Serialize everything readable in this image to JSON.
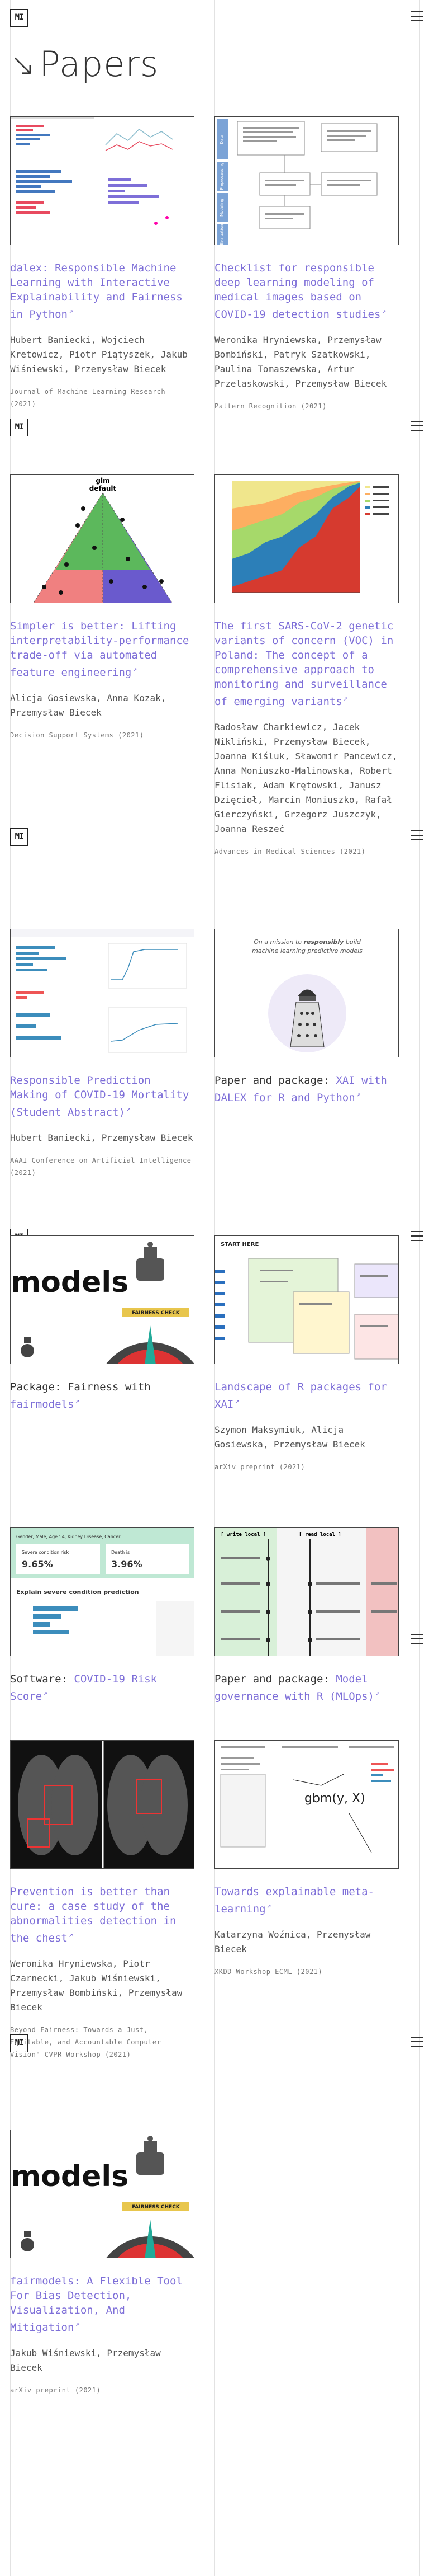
{
  "header": {
    "logo_text": "MI",
    "menu_icon": "hamburger-icon"
  },
  "page_title": "Papers",
  "title_icon": "arrow-down-right-icon",
  "external_icon_glyph": "↗",
  "papers": [
    {
      "title": "dalex: Responsible Machine Learning with Interactive Explainability and Fairness in Python",
      "prefix": "",
      "authors": "Hubert Baniecki, Wojciech Kretowicz, Piotr Piątyszek, Jakub Wiśniewski, Przemysław Biecek",
      "venue": "Journal of Machine Learning Research (2021)"
    },
    {
      "title": "Checklist for responsible deep learning modeling of medical images based on COVID-19 detection studies",
      "prefix": "",
      "authors": "Weronika Hryniewska, Przemysław Bombiński, Patryk Szatkowski, Paulina Tomaszewska, Artur Przelaskowski, Przemysław Biecek",
      "venue": "Pattern Recognition (2021)"
    },
    {
      "title": "Simpler is better: Lifting interpretability-performance trade-off via automated feature engineering",
      "prefix": "",
      "authors": "Alicja Gosiewska, Anna Kozak, Przemysław Biecek",
      "venue": "Decision Support Systems (2021)"
    },
    {
      "title": "The first SARS-CoV-2 genetic variants of concern (VOC) in Poland: The concept of a comprehensive approach to monitoring and surveillance of emerging variants",
      "prefix": "",
      "authors": "Radosław Charkiewicz, Jacek Nikliński, Przemysław Biecek, Joanna Kiśluk, Sławomir Pancewicz, Anna Moniuszko-Malinowska, Robert Flisiak, Adam Krętowski, Janusz Dzięcioł, Marcin Moniuszko, Rafał Gierczyński, Grzegorz Juszczyk, Joanna Reszeć",
      "venue": "Advances in Medical Sciences (2021)"
    },
    {
      "title": "Responsible Prediction Making of COVID-19 Mortality (Student Abstract)",
      "prefix": "",
      "authors": "Hubert Baniecki, Przemysław Biecek",
      "venue": "AAAI Conference on Artificial Intelligence (2021)"
    },
    {
      "title": "XAI with DALEX for R and Python",
      "prefix": "Paper and package: ",
      "authors": "",
      "venue": ""
    },
    {
      "title": "fairmodels",
      "prefix": "Package: Fairness with ",
      "authors": "",
      "venue": ""
    },
    {
      "title": "Landscape of R packages for XAI",
      "prefix": "",
      "authors": "Szymon Maksymiuk, Alicja Gosiewska, Przemysław Biecek",
      "venue": "arXiv preprint (2021)"
    },
    {
      "title": "COVID-19 Risk Score",
      "prefix": "Software: ",
      "authors": "",
      "venue": ""
    },
    {
      "title": "Model governance with R (MLOps)",
      "prefix": "Paper and package: ",
      "authors": "",
      "venue": ""
    },
    {
      "title": "Prevention is better than cure: a case study of the abnormalities detection in the chest",
      "prefix": "",
      "authors": "Weronika Hryniewska, Piotr Czarnecki, Jakub Wiśniewski, Przemysław Bombiński, Przemysław Biecek",
      "venue": "Beyond Fairness: Towards a Just, Equitable, and Accountable Computer Vision\" CVPR Workshop (2021)"
    },
    {
      "title": "Towards explainable meta-learning",
      "prefix": "",
      "authors": "Katarzyna Woźnica, Przemysław Biecek",
      "venue": "XKDD Workshop ECML (2021)"
    },
    {
      "title": "fairmodels: A Flexible Tool For Bias Detection, Visualization, And Mitigation",
      "prefix": "",
      "authors": "Jakub Wiśniewski, Przemysław Biecek",
      "venue": "arXiv preprint (2021)"
    }
  ],
  "thumbs": {
    "t2": {
      "boxes": [
        "Data",
        "Preprocessing",
        "Modeling",
        "Evaluation"
      ]
    },
    "t3": {
      "title": "glm",
      "subtitle": "default"
    },
    "t6": {
      "line1": "On a mission to",
      "bold": "responsibly",
      "line2": "build",
      "line3": "machine learning predictive models"
    },
    "t7": {
      "text": "models",
      "banner": "FAIRNESS CHECK"
    },
    "t8": {
      "heading": "START HERE"
    },
    "t9": {
      "header": "Gender, Male, Age 54, Kidney Disease, Cancer",
      "risk1_label": "Severe condition risk",
      "risk1": "9.65%",
      "risk2_label": "Death is",
      "risk2": "3.96%",
      "explain": "Explain severe condition prediction"
    },
    "t10": {
      "col1": "[ write local ]",
      "col2": "[ read local ]",
      "formula": "gbm(y, X)"
    },
    "t13": {
      "text": "models",
      "banner": "FAIRNESS CHECK"
    }
  }
}
